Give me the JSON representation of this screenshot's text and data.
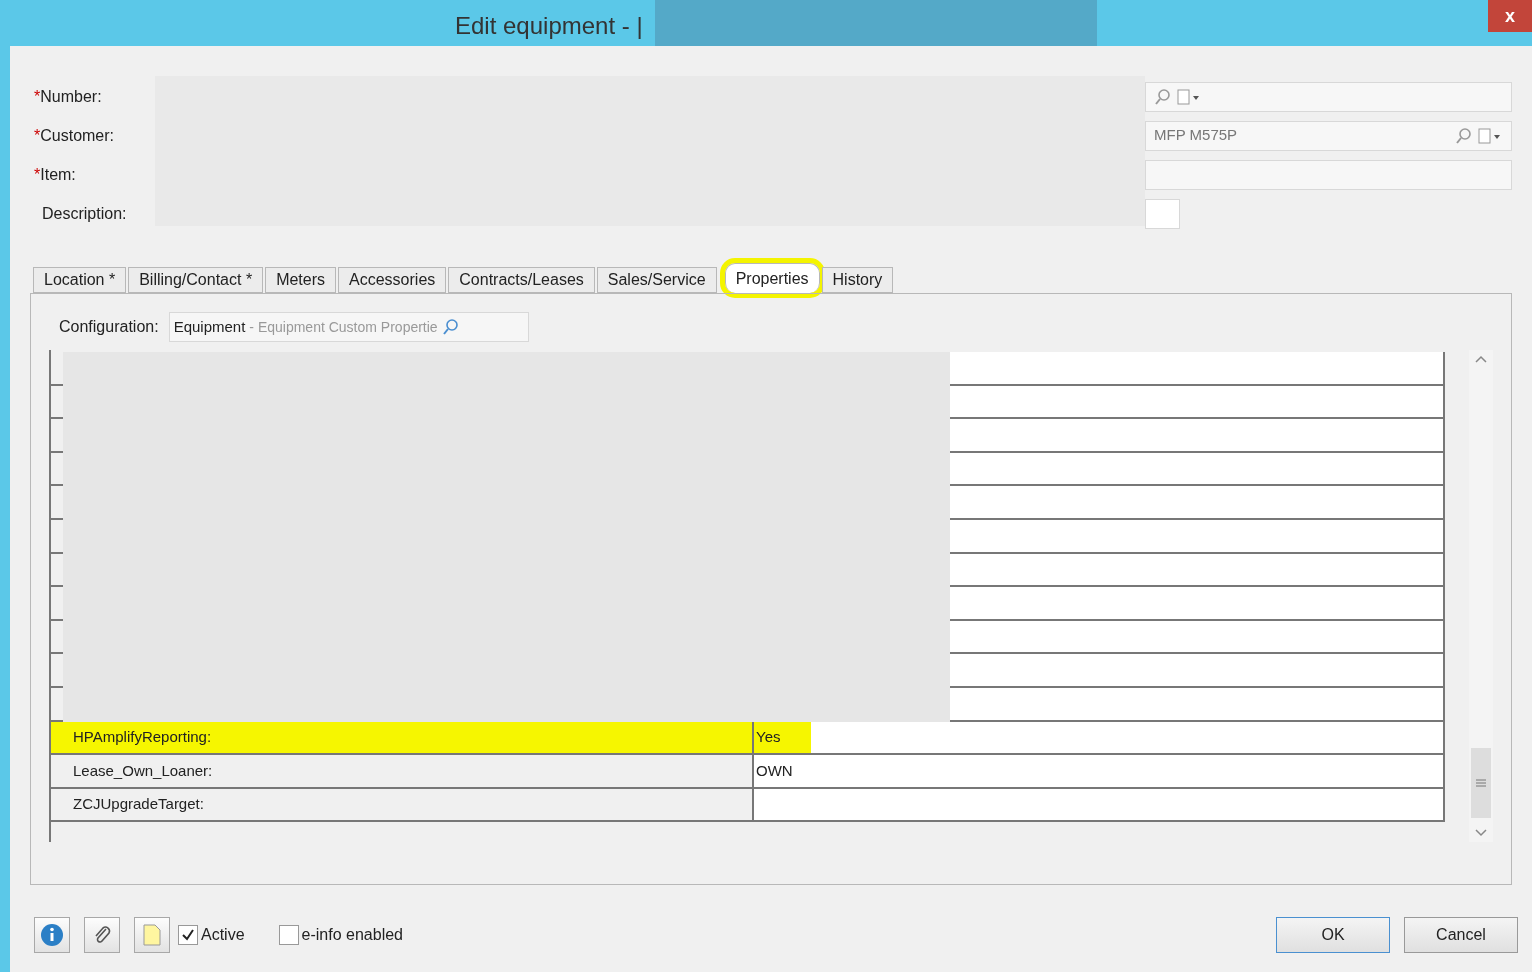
{
  "window": {
    "title": "Edit equipment - |",
    "close": "x"
  },
  "fields": [
    {
      "label": "Number:",
      "required": true,
      "required_mark": "*"
    },
    {
      "label": "Customer:",
      "required": true,
      "required_mark": "*",
      "value": "MFP M575P"
    },
    {
      "label": "Item:",
      "required": true,
      "required_mark": "*"
    },
    {
      "label": "Description:",
      "required": false
    }
  ],
  "tabs": [
    {
      "label": "Location *",
      "selected": false,
      "highlighted": false
    },
    {
      "label": "Billing/Contact *",
      "selected": false,
      "highlighted": false
    },
    {
      "label": "Meters",
      "selected": false,
      "highlighted": false
    },
    {
      "label": "Accessories",
      "selected": false,
      "highlighted": false
    },
    {
      "label": "Contracts/Leases",
      "selected": false,
      "highlighted": false
    },
    {
      "label": "Sales/Service",
      "selected": false,
      "highlighted": false
    },
    {
      "label": "Properties",
      "selected": true,
      "highlighted": true
    },
    {
      "label": "History",
      "selected": false,
      "highlighted": false
    }
  ],
  "configuration": {
    "label": "Configuration:",
    "value": "Equipment",
    "detail": "- Equipment Custom Propertie"
  },
  "properties": [
    {
      "name": "HPAmplifyReporting:",
      "value": "Yes",
      "highlighted": true
    },
    {
      "name": "Lease_Own_Loaner:",
      "value": "OWN",
      "highlighted": false
    },
    {
      "name": "ZCJUpgradeTarget:",
      "highlighted": false
    }
  ],
  "footer": {
    "checkboxes": [
      {
        "label": "Active",
        "checked": true
      },
      {
        "label": "e-info enabled",
        "checked": false
      }
    ],
    "buttons": [
      "OK",
      "Cancel"
    ]
  }
}
